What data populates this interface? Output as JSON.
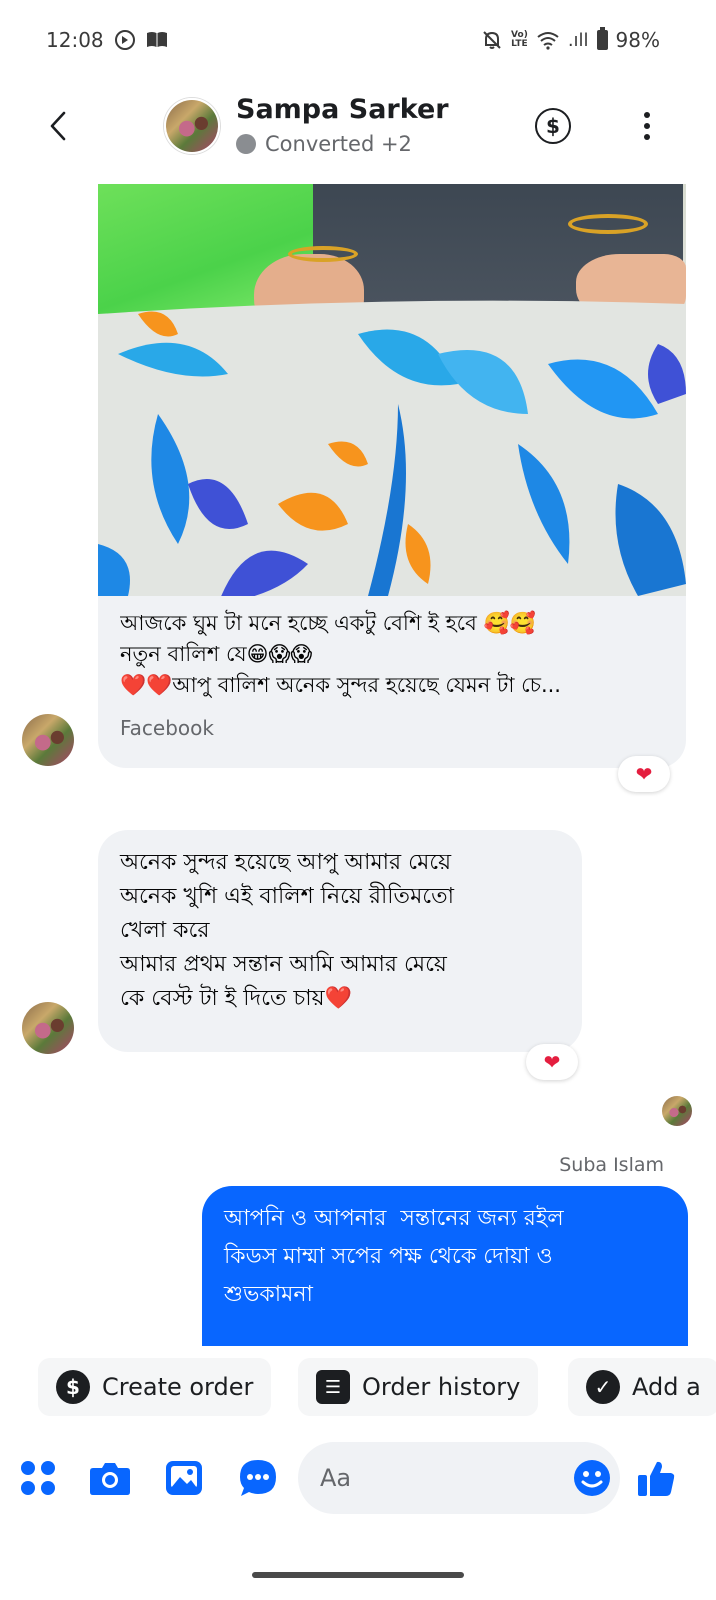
{
  "status_bar": {
    "time": "12:08",
    "battery": "98%",
    "signal_label": ".ıll",
    "volte_top": "Vo)",
    "volte_bottom": "LTE"
  },
  "header": {
    "name": "Sampa Sarker",
    "status": "Converted +2",
    "currency_symbol": "$"
  },
  "messages": {
    "shared_post": {
      "lines": [
        "আজকে ঘুম টা মনে হচ্ছে একটু বেশি ই হবে 🥰🥰",
        "নতুন বালিশ যে😁😱😱",
        "❤️❤️আপু বালিশ অনেক সুন্দর হয়েছে যেমন টা চে..."
      ],
      "source": "Facebook",
      "reaction": "❤"
    },
    "incoming": {
      "lines": [
        "অনেক সুন্দর হয়েছে আপু আমার মেয়ে",
        "অনেক খুশি এই বালিশ নিয়ে রীতিমতো",
        "খেলা করে",
        "আমার প্রথম সন্তান আমি আমার মেয়ে",
        "কে বেস্ট টা ই দিতে চায়❤️"
      ],
      "reaction": "❤"
    },
    "outgoing": {
      "sender": "Suba Islam",
      "lines": [
        "আপনি ও আপনার  সন্তানের জন্য রইল",
        "কিডস মাম্মা সপের পক্ষ থেকে দোয়া ও",
        "শুভকামনা"
      ]
    }
  },
  "quick_actions": [
    {
      "label": "Create order",
      "icon": "dollar-icon",
      "glyph": "$"
    },
    {
      "label": "Order history",
      "icon": "receipt-icon",
      "glyph": "☰"
    },
    {
      "label": "Add a",
      "icon": "checkmark-icon",
      "glyph": "✓"
    }
  ],
  "composer": {
    "placeholder": "Aa"
  },
  "colors": {
    "accent": "#0866ff",
    "bubble_in": "#f0f2f5",
    "reaction": "#e41e3f"
  }
}
